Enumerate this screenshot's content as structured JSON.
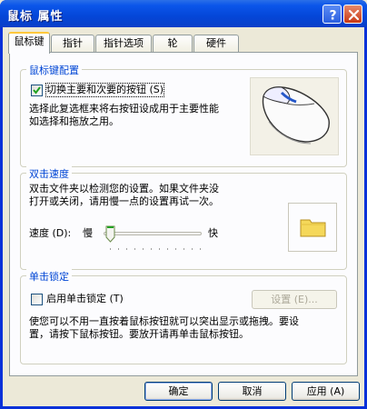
{
  "window": {
    "title": "鼠标 属性"
  },
  "tabs": [
    {
      "label": "鼠标键",
      "active": true
    },
    {
      "label": "指针",
      "active": false
    },
    {
      "label": "指针选项",
      "active": false
    },
    {
      "label": "轮",
      "active": false
    },
    {
      "label": "硬件",
      "active": false
    }
  ],
  "button_config": {
    "group_title": "鼠标键配置",
    "swap_checkbox": {
      "label": "切换主要和次要的按钮 (S)",
      "checked": true
    },
    "description": [
      "选择此复选框来将右按钮设成用于主要性能",
      "如选择和拖放之用。"
    ]
  },
  "double_click": {
    "group_title": "双击速度",
    "description": [
      "双击文件夹以检测您的设置。如果文件夹没",
      "打开或关闭，请用慢一点的设置再试一次。"
    ],
    "speed_label": "速度 (D):",
    "slow_label": "慢",
    "fast_label": "快",
    "slider_value_fraction": 0.0
  },
  "click_lock": {
    "group_title": "单击锁定",
    "checkbox": {
      "label": "启用单击锁定 (T)",
      "checked": false
    },
    "settings_button": "设置 (E)...",
    "description": [
      "使您可以不用一直按着鼠标按钮就可以突出显示或拖拽。要设",
      "置，请按下鼠标按钮。要放开请再单击鼠标按钮。"
    ]
  },
  "footer": {
    "ok": "确定",
    "cancel": "取消",
    "apply": "应用 (A)"
  },
  "colors": {
    "titlebar": "#0b56ea",
    "group_title": "#0046d5",
    "folder": "#f5d85a"
  },
  "icons": [
    "help-icon",
    "close-icon",
    "mouse-icon",
    "folder-icon",
    "checkmark-icon"
  ]
}
